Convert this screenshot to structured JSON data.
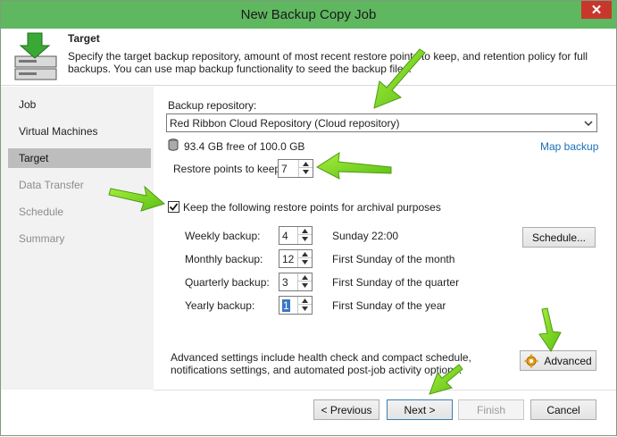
{
  "window": {
    "title": "New Backup Copy Job",
    "close_glyph": "✕"
  },
  "header": {
    "title": "Target",
    "description": "Specify the target backup repository, amount of most recent restore points to keep, and retention policy for full backups. You can use map backup functionality to seed the backup files.",
    "icon": "server-download-icon"
  },
  "sidebar": {
    "items": [
      {
        "label": "Job",
        "state": "normal"
      },
      {
        "label": "Virtual Machines",
        "state": "normal"
      },
      {
        "label": "Target",
        "state": "active"
      },
      {
        "label": "Data Transfer",
        "state": "disabled"
      },
      {
        "label": "Schedule",
        "state": "disabled"
      },
      {
        "label": "Summary",
        "state": "disabled"
      }
    ]
  },
  "target": {
    "repository_label": "Backup repository:",
    "repository_value": "Red Ribbon Cloud Repository (Cloud repository)",
    "free_space": "93.4 GB free of 100.0 GB",
    "map_backup_link": "Map backup",
    "restore_points_label": "Restore points to keep:",
    "restore_points_value": "7",
    "archival_checkbox_label": "Keep the following restore points for archival purposes",
    "archival_checked": true,
    "retention": [
      {
        "label": "Weekly backup:",
        "value": "4",
        "desc": "Sunday 22:00"
      },
      {
        "label": "Monthly backup:",
        "value": "12",
        "desc": "First Sunday of the month"
      },
      {
        "label": "Quarterly backup:",
        "value": "3",
        "desc": "First Sunday of the quarter"
      },
      {
        "label": "Yearly backup:",
        "value": "1",
        "desc": "First Sunday of the year"
      }
    ],
    "schedule_button": "Schedule...",
    "advanced_text": "Advanced settings include health check and compact schedule, notifications settings, and automated post-job activity options.",
    "advanced_button": "Advanced"
  },
  "footer": {
    "previous": "< Previous",
    "next": "Next >",
    "finish": "Finish",
    "cancel": "Cancel"
  },
  "colors": {
    "titlebar": "#5fb75f",
    "close": "#c7372b",
    "link": "#1c6fb8",
    "annotation_arrow": "#7fd42a"
  }
}
